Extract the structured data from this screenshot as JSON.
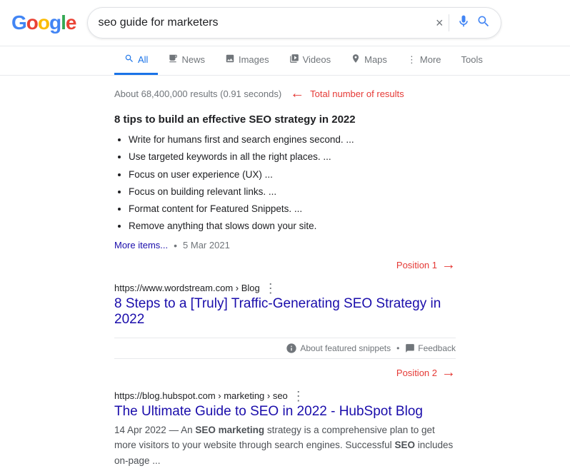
{
  "header": {
    "logo_letters": [
      "G",
      "o",
      "o",
      "g",
      "l",
      "e"
    ],
    "search_query": "seo guide for marketers",
    "clear_button": "×",
    "voice_icon": "🎤",
    "search_icon": "🔍"
  },
  "tabs": [
    {
      "id": "all",
      "label": "All",
      "icon": "🔍",
      "active": true
    },
    {
      "id": "news",
      "label": "News",
      "icon": "📰",
      "active": false
    },
    {
      "id": "images",
      "label": "Images",
      "icon": "🖼",
      "active": false
    },
    {
      "id": "videos",
      "label": "Videos",
      "icon": "▶",
      "active": false
    },
    {
      "id": "maps",
      "label": "Maps",
      "icon": "📍",
      "active": false
    },
    {
      "id": "more",
      "label": "More",
      "icon": "⋮",
      "active": false
    },
    {
      "id": "tools",
      "label": "Tools",
      "active": false
    }
  ],
  "results": {
    "count_text": "About 68,400,000 results (0.91 seconds)",
    "count_annotation": "Total number of results",
    "featured_snippet": {
      "title": "8 tips to build an effective SEO strategy in 2022",
      "items": [
        "Write for humans first and search engines second. ...",
        "Use targeted keywords in all the right places. ...",
        "Focus on user experience (UX) ...",
        "Focus on building relevant links. ...",
        "Format content for Featured Snippets. ...",
        "Remove anything that slows down your site."
      ],
      "more_items_text": "More items...",
      "date": "5 Mar 2021"
    },
    "position1_annotation": "Position 1",
    "result1": {
      "url": "https://www.wordstream.com › Blog",
      "title": "8 Steps to a [Truly] Traffic-Generating SEO Strategy in 2022",
      "three_dots": "⋮"
    },
    "snippet_footer": {
      "about": "About featured snippets",
      "feedback": "Feedback"
    },
    "position2_annotation": "Position 2",
    "result2": {
      "url": "https://blog.hubspot.com › marketing › seo",
      "title": "The Ultimate Guide to SEO in 2022 - HubSpot Blog",
      "three_dots": "⋮",
      "date": "14 Apr 2022",
      "snippet": "— An SEO marketing strategy is a comprehensive plan to get more visitors to your website through search engines. Successful SEO includes on-page ..."
    }
  }
}
